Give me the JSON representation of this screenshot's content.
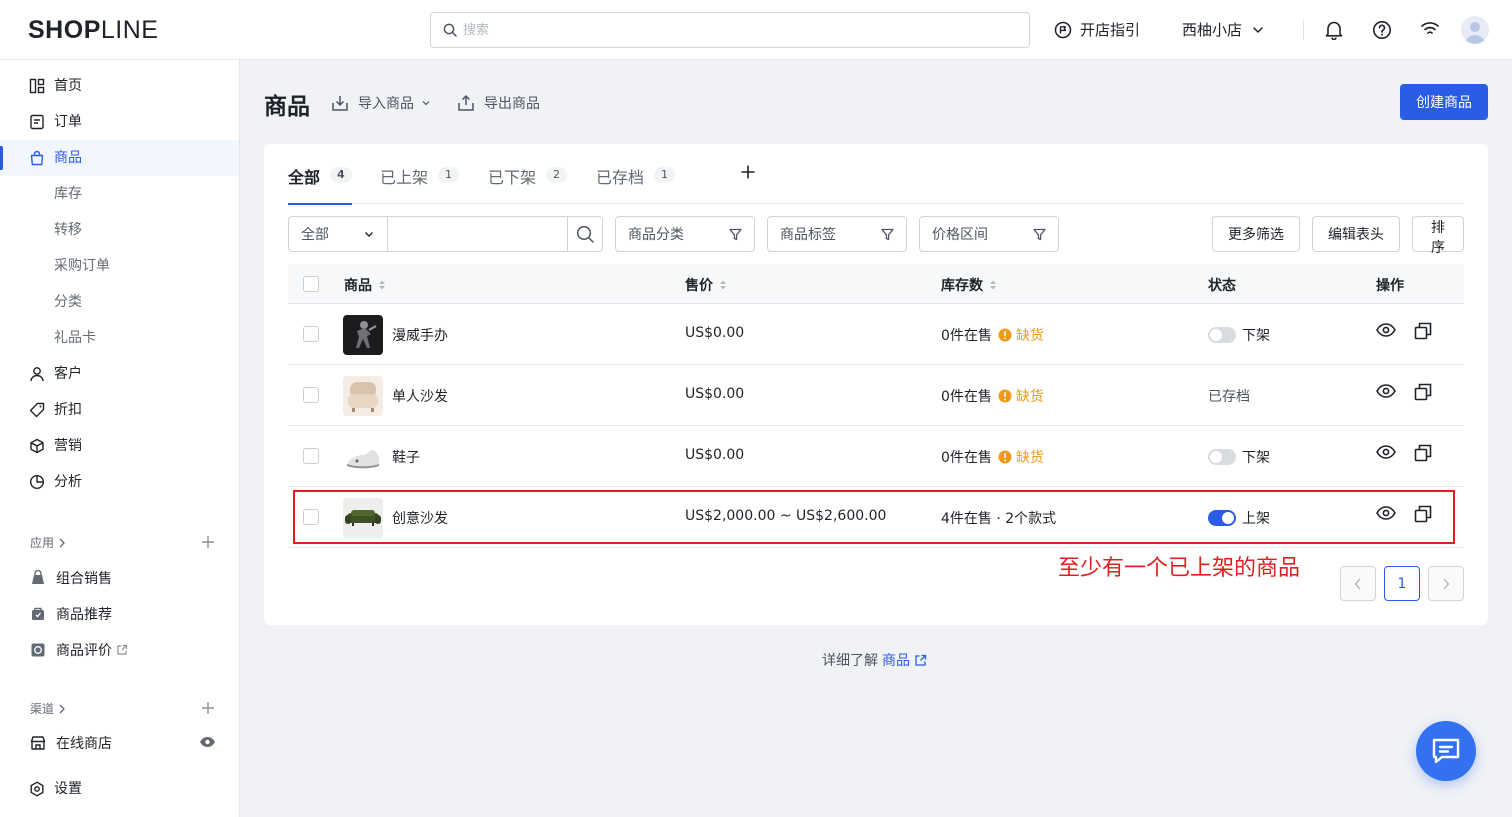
{
  "brand": {
    "logo": "SHOPLINE"
  },
  "topbar": {
    "search_placeholder": "搜索",
    "guide_label": "开店指引",
    "store_name": "西柚小店"
  },
  "sidebar": {
    "items": [
      {
        "label": "首页",
        "icon": "home-grid-icon"
      },
      {
        "label": "订单",
        "icon": "order-icon"
      },
      {
        "label": "商品",
        "icon": "bag-icon"
      },
      {
        "label": "客户",
        "icon": "user-icon"
      },
      {
        "label": "折扣",
        "icon": "tag-icon"
      },
      {
        "label": "营销",
        "icon": "cube-icon"
      },
      {
        "label": "分析",
        "icon": "pie-icon"
      }
    ],
    "product_sub": [
      "库存",
      "转移",
      "采购订单",
      "分类",
      "礼品卡"
    ],
    "apps_title": "应用",
    "apps": [
      "组合销售",
      "商品推荐",
      "商品评价"
    ],
    "channels_title": "渠道",
    "channels": [
      "在线商店"
    ],
    "settings": "设置"
  },
  "page": {
    "title": "商品",
    "import_label": "导入商品",
    "export_label": "导出商品",
    "create_label": "创建商品"
  },
  "tabs": [
    {
      "label": "全部",
      "count": "4"
    },
    {
      "label": "已上架",
      "count": "1"
    },
    {
      "label": "已下架",
      "count": "2"
    },
    {
      "label": "已存档",
      "count": "1"
    }
  ],
  "filters": {
    "scope": "全部",
    "category": "商品分类",
    "tag": "商品标签",
    "price": "价格区间",
    "more": "更多筛选",
    "edit_header": "编辑表头",
    "sort": "排序"
  },
  "table": {
    "columns": [
      "商品",
      "售价",
      "库存数",
      "状态",
      "操作"
    ],
    "rows": [
      {
        "name": "漫威手办",
        "price": "US$0.00",
        "stock": "0件在售",
        "stock_flag": "缺货",
        "status": "下架",
        "status_type": "toggle-off"
      },
      {
        "name": "单人沙发",
        "price": "US$0.00",
        "stock": "0件在售",
        "stock_flag": "缺货",
        "status": "已存档",
        "status_type": "text"
      },
      {
        "name": "鞋子",
        "price": "US$0.00",
        "stock": "0件在售",
        "stock_flag": "缺货",
        "status": "下架",
        "status_type": "toggle-off"
      },
      {
        "name": "创意沙发",
        "price": "US$2,000.00 ~ US$2,600.00",
        "stock": "4件在售 · 2个款式",
        "stock_flag": "",
        "status": "上架",
        "status_type": "toggle-on"
      }
    ]
  },
  "annotation": "至少有一个已上架的商品",
  "pagination": {
    "current": "1"
  },
  "footer": {
    "prefix": "详细了解",
    "link": "商品"
  },
  "colors": {
    "primary": "#2b5ce6",
    "warning": "#f09a1a",
    "annotation": "#e02020"
  }
}
